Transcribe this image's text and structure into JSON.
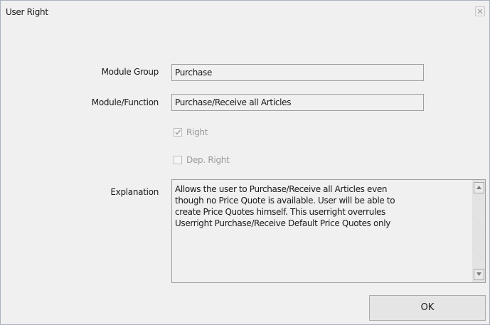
{
  "window": {
    "title": "User Right",
    "close_icon": "close-icon"
  },
  "form": {
    "module_group": {
      "label": "Module Group",
      "value": "Purchase"
    },
    "module_function": {
      "label": "Module/Function",
      "value": "Purchase/Receive all Articles"
    },
    "right": {
      "label": "Right",
      "checked": true,
      "enabled": false
    },
    "dep_right": {
      "label": "Dep. Right",
      "checked": false,
      "enabled": false
    },
    "explanation": {
      "label": "Explanation",
      "lines": [
        "Allows the user to Purchase/Receive all Articles even",
        "though no Price Quote is available. User will be able to",
        "create Price Quotes himself. This userright overrules",
        "Userright Purchase/Receive Default Price Quotes only"
      ]
    }
  },
  "buttons": {
    "ok_label": "OK"
  },
  "colors": {
    "background": "#f0f0f0",
    "field_border": "#9f9f9f",
    "disabled_text": "#9a9a9a"
  }
}
